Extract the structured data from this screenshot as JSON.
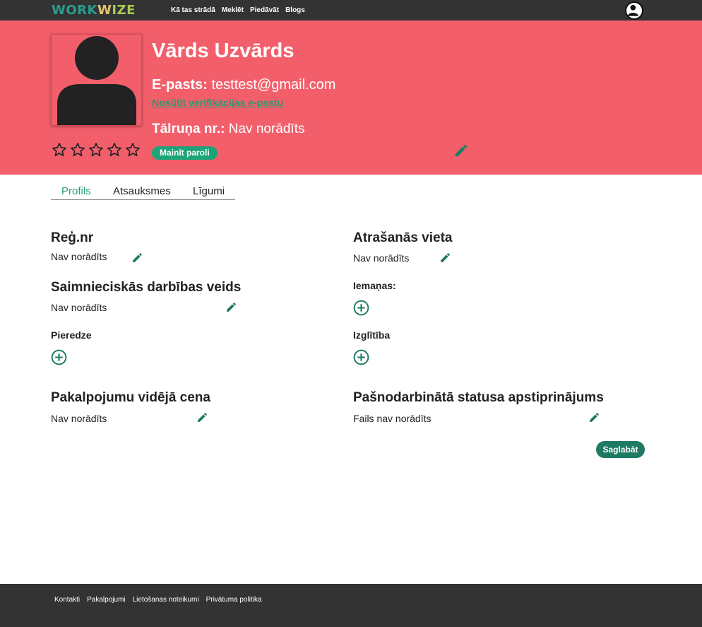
{
  "nav": {
    "logo_part1": "WORK",
    "logo_part2": "W",
    "logo_part3": "IZE",
    "links": [
      "Kā tas strādā",
      "Meklēt",
      "Piedāvāt",
      "Blogs"
    ]
  },
  "profile": {
    "name": "Vārds Uzvārds",
    "email_label": "E-pasts:",
    "email_value": "testtest@gmail.com",
    "verify_link": "Nosūtīt verifikācijas e-pastu",
    "phone_label": "Tālruņa nr.:",
    "phone_value": "Nav norādīts",
    "rating_stars": 5,
    "rating_value": 0,
    "change_password": "Mainīt paroli"
  },
  "tabs": [
    "Profils",
    "Atsauksmes",
    "Līgumi"
  ],
  "fields": {
    "reg_label": "Reģ.nr",
    "reg_value": "Nav norādīts",
    "activity_label": "Saimnieciskās darbības veids",
    "activity_value": "Nav norādīts",
    "experience_label": "Pieredze",
    "price_label": "Pakalpojumu vidējā cena",
    "price_value": "Nav norādīts",
    "location_label": "Atrašanās vieta",
    "location_value": "Nav norādīts",
    "skills_label": "Iemaņas:",
    "education_label": "Izglītība",
    "status_label": "Pašnodarbinātā statusa apstiprinājums",
    "status_value": "Fails nav norādīts",
    "save_button": "Saglabāt"
  },
  "footer": {
    "links": [
      "Kontakti",
      "Pakalpojumi",
      "Lietošanas noteikumi",
      "Privātuma politika"
    ]
  },
  "colors": {
    "topbar": "#333333",
    "hero": "#f25f6b",
    "accent": "#1aa477",
    "save": "#1e7a62",
    "icon": "#1e7a62"
  }
}
